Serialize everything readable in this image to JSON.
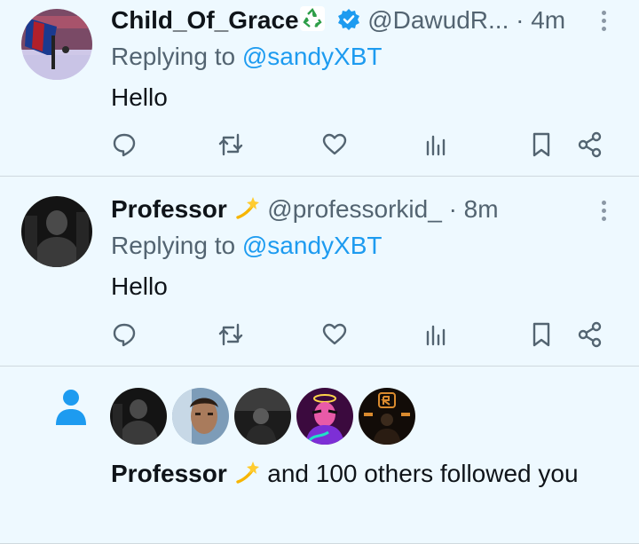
{
  "tweets": [
    {
      "display_name": "Child_Of_Grace",
      "name_emoji": "recycle-emoji",
      "verified": true,
      "handle": "@DawudR...",
      "time": "· 4m",
      "replying_prefix": "Replying to",
      "replying_to": "@sandyXBT",
      "text": "Hello"
    },
    {
      "display_name": "Professor",
      "name_emoji": "dizzy-emoji",
      "verified": false,
      "handle": "@professorkid_",
      "time": "· 8m",
      "replying_prefix": "Replying to",
      "replying_to": "@sandyXBT",
      "text": "Hello"
    }
  ],
  "action_icons": [
    "reply-icon",
    "retweet-icon",
    "like-icon",
    "views-icon",
    "bookmark-icon",
    "share-icon"
  ],
  "notification": {
    "icon": "person-icon",
    "name": "Professor",
    "text_rest": " and 100 others followed you",
    "avatar_count": 5
  },
  "colors": {
    "background": "#eef9ff",
    "link": "#1d9bf0",
    "muted": "#536471",
    "text": "#0f1419",
    "verified": "#1d9bf0"
  }
}
